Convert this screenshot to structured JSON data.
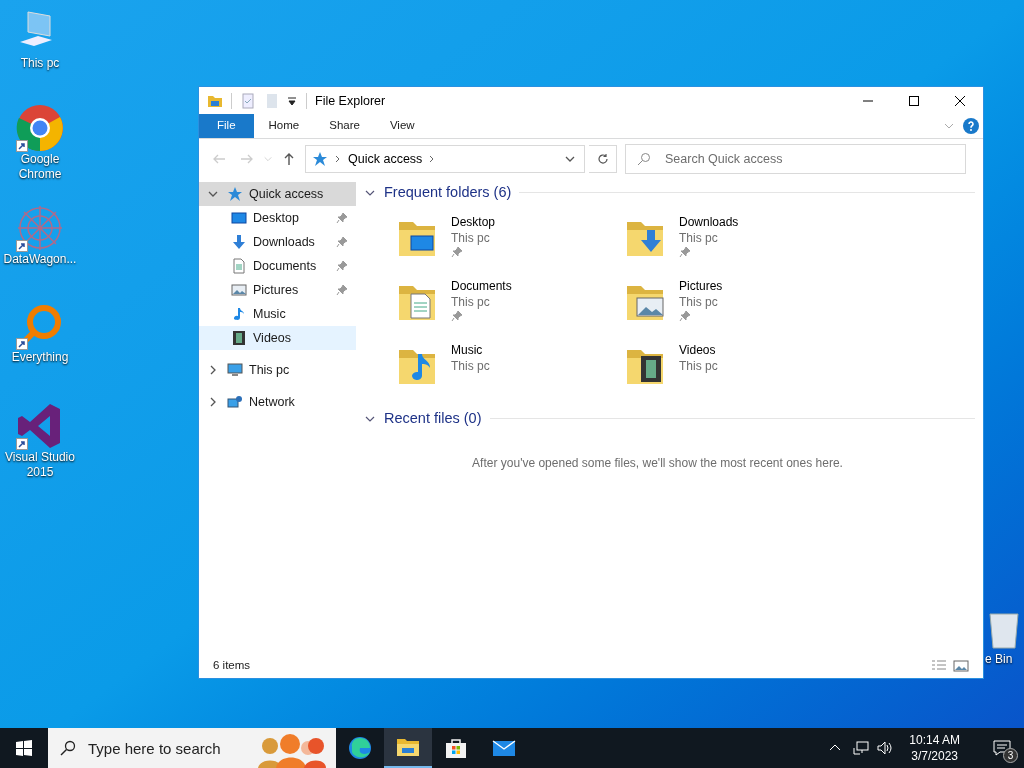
{
  "desktop_icons": [
    {
      "kind": "computer",
      "label": "This pc"
    },
    {
      "kind": "chrome",
      "label": "Google Chrome"
    },
    {
      "kind": "datawagon",
      "label": "DataWagon..."
    },
    {
      "kind": "everything",
      "label": "Everything"
    },
    {
      "kind": "visualstudio",
      "label": "Visual Studio 2015"
    },
    {
      "kind": "recycle",
      "label": "e Bin"
    }
  ],
  "window": {
    "title": "File Explorer",
    "ribbon_tabs": [
      {
        "label": "File",
        "kind": "file"
      },
      {
        "label": "Home",
        "kind": "tab"
      },
      {
        "label": "Share",
        "kind": "tab"
      },
      {
        "label": "View",
        "kind": "tab"
      }
    ],
    "address": {
      "location": "Quick access"
    },
    "search": {
      "placeholder": "Search Quick access"
    },
    "nav": [
      {
        "label": "Quick access",
        "kind": "star",
        "expanded": true,
        "selected": true,
        "hovered": false,
        "children": [
          {
            "label": "Desktop",
            "kind": "desktop",
            "pinned": true,
            "selected": false,
            "hovered": false
          },
          {
            "label": "Downloads",
            "kind": "downloads",
            "pinned": true,
            "selected": false,
            "hovered": false
          },
          {
            "label": "Documents",
            "kind": "documents",
            "pinned": true,
            "selected": false,
            "hovered": false
          },
          {
            "label": "Pictures",
            "kind": "pictures",
            "pinned": true,
            "selected": false,
            "hovered": false
          },
          {
            "label": "Music",
            "kind": "music",
            "pinned": false,
            "selected": false,
            "hovered": false
          },
          {
            "label": "Videos",
            "kind": "videos",
            "pinned": false,
            "selected": false,
            "hovered": true
          }
        ]
      },
      {
        "label": "This pc",
        "kind": "computer",
        "expanded": false,
        "selected": false,
        "hovered": false
      },
      {
        "label": "Network",
        "kind": "network",
        "expanded": false,
        "selected": false,
        "hovered": false
      }
    ],
    "frequent": {
      "title": "Frequent folders (6)",
      "expanded": true,
      "folders": [
        {
          "name": "Desktop",
          "location": "This pc",
          "pinned": true,
          "kind": "desktop"
        },
        {
          "name": "Downloads",
          "location": "This pc",
          "pinned": true,
          "kind": "downloads"
        },
        {
          "name": "Documents",
          "location": "This pc",
          "pinned": true,
          "kind": "documents"
        },
        {
          "name": "Pictures",
          "location": "This pc",
          "pinned": true,
          "kind": "pictures"
        },
        {
          "name": "Music",
          "location": "This pc",
          "pinned": false,
          "kind": "music"
        },
        {
          "name": "Videos",
          "location": "This pc",
          "pinned": false,
          "kind": "videos"
        }
      ]
    },
    "recent": {
      "title": "Recent files (0)",
      "expanded": true,
      "empty_message": "After you've opened some files, we'll show the most recent ones here."
    },
    "status": "6 items"
  },
  "taskbar": {
    "search_placeholder": "Type here to search",
    "apps": [
      {
        "kind": "edge",
        "active": false
      },
      {
        "kind": "explorer",
        "active": true
      },
      {
        "kind": "store",
        "active": false
      },
      {
        "kind": "mail",
        "active": false
      }
    ],
    "time": "10:14 AM",
    "date": "3/7/2023",
    "notifications": "3"
  }
}
